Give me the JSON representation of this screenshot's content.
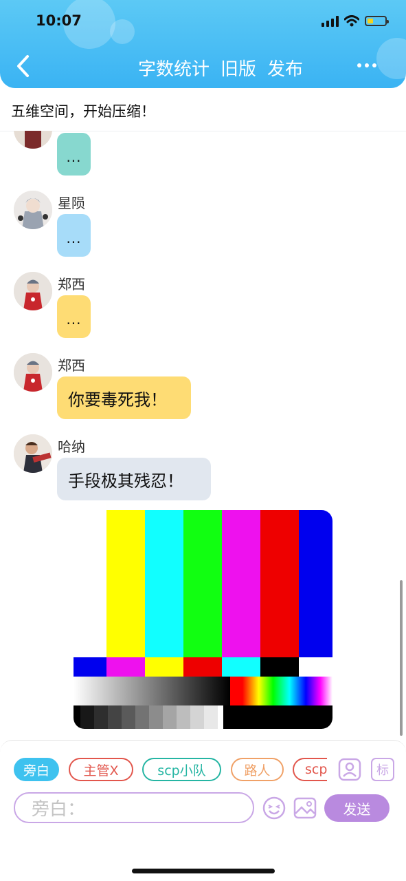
{
  "status": {
    "time": "10:07"
  },
  "header": {
    "nav": [
      "字数统计",
      "旧版",
      "发布"
    ]
  },
  "title": "五维空间，开始压缩！",
  "messages": [
    {
      "name": "",
      "text": "...",
      "color": "#87d8cf"
    },
    {
      "name": "星陨",
      "text": "...",
      "color": "#a7dcf9"
    },
    {
      "name": "郑西",
      "text": "...",
      "color": "#fedc74"
    },
    {
      "name": "郑西",
      "text": "你要毒死我！",
      "color": "#fedc74"
    },
    {
      "name": "哈纳",
      "text": "手段极其残忍！",
      "color": "#e1e7ef"
    }
  ],
  "image_message": {
    "icon": "color-bars-test-pattern-image"
  },
  "chips": [
    {
      "label": "旁白",
      "active": true
    },
    {
      "label": "主管X",
      "color": "#e2564c"
    },
    {
      "label": "scp小队",
      "color": "#25b5a3"
    },
    {
      "label": "路人",
      "color": "#f0a167"
    },
    {
      "label": "scp",
      "color": "#e2564c"
    }
  ],
  "input": {
    "placeholder": "旁白："
  },
  "send_label": "发送",
  "tool_icons": [
    "role-card-icon",
    "tag-icon",
    "emoji-icon",
    "image-icon"
  ],
  "tag_label": "标",
  "colors": {
    "header": "#3ab3f3",
    "accent_purple": "#b98adf",
    "active_chip": "#3ec2ef"
  }
}
